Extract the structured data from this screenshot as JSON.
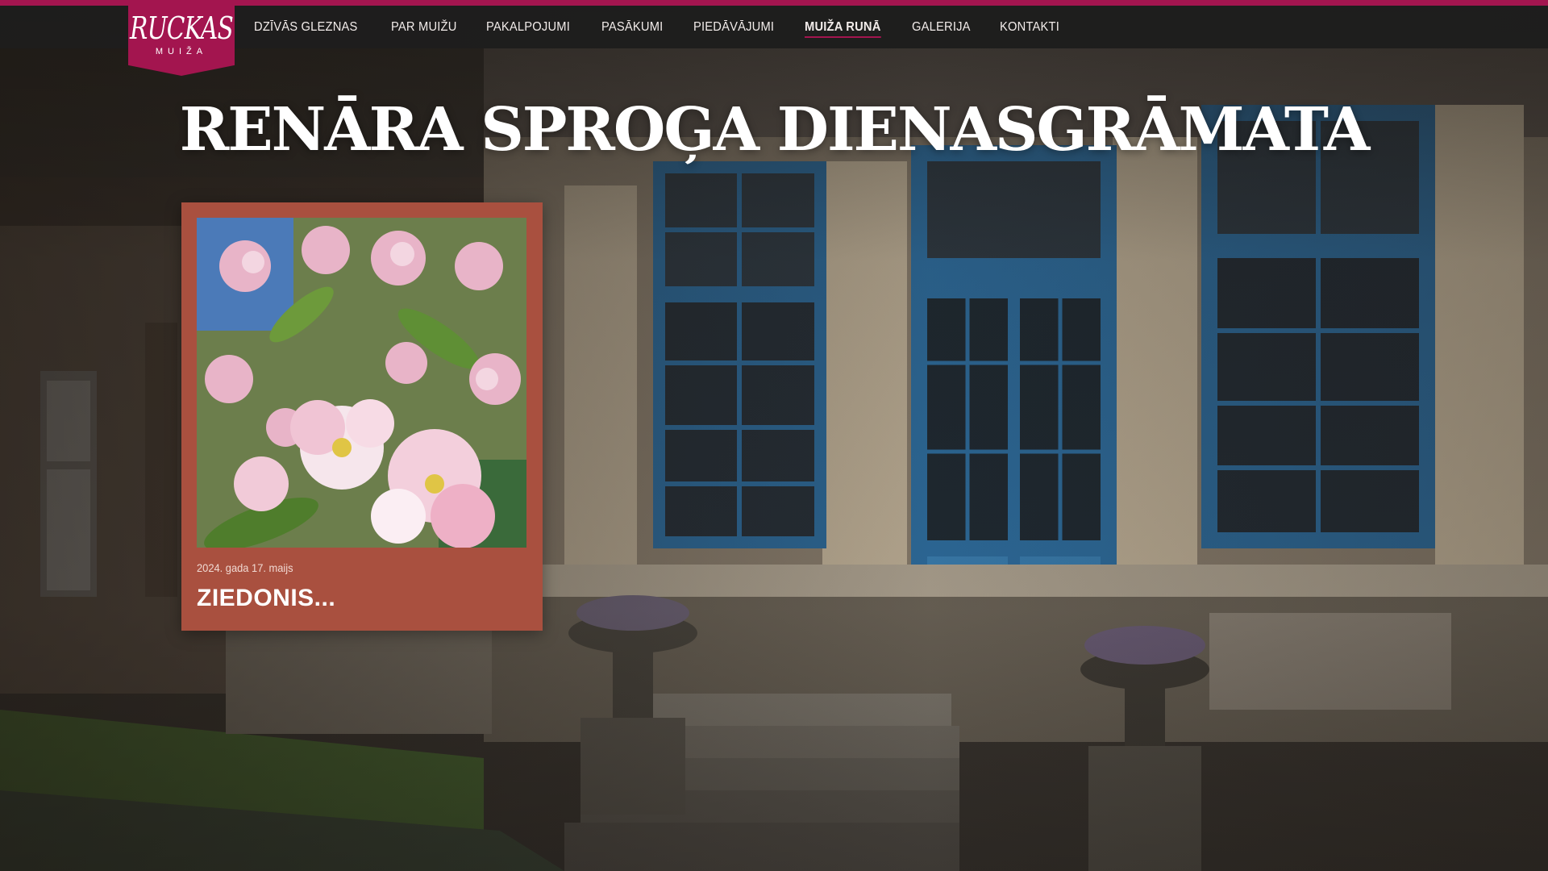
{
  "brand": {
    "logo_word": "RUCKAS",
    "logo_sub": "MUIŽA",
    "accent_color": "#a3154f"
  },
  "nav": {
    "items": [
      {
        "label": "DZĪVĀS GLEZNAS"
      },
      {
        "label": "PAR MUIŽU"
      },
      {
        "label": "PAKALPOJUMI"
      },
      {
        "label": "PASĀKUMI"
      },
      {
        "label": "PIEDĀVĀJUMI"
      },
      {
        "label": "MUIŽA RUNĀ",
        "active": true
      },
      {
        "label": "GALERIJA"
      },
      {
        "label": "KONTAKTI"
      }
    ]
  },
  "page": {
    "title": "RENĀRA SPROĢA DIENASGRĀMATA"
  },
  "posts": [
    {
      "date": "2024. gada 17. maijs",
      "title": "ZIEDONIS...",
      "card_color": "#a9503f"
    }
  ]
}
